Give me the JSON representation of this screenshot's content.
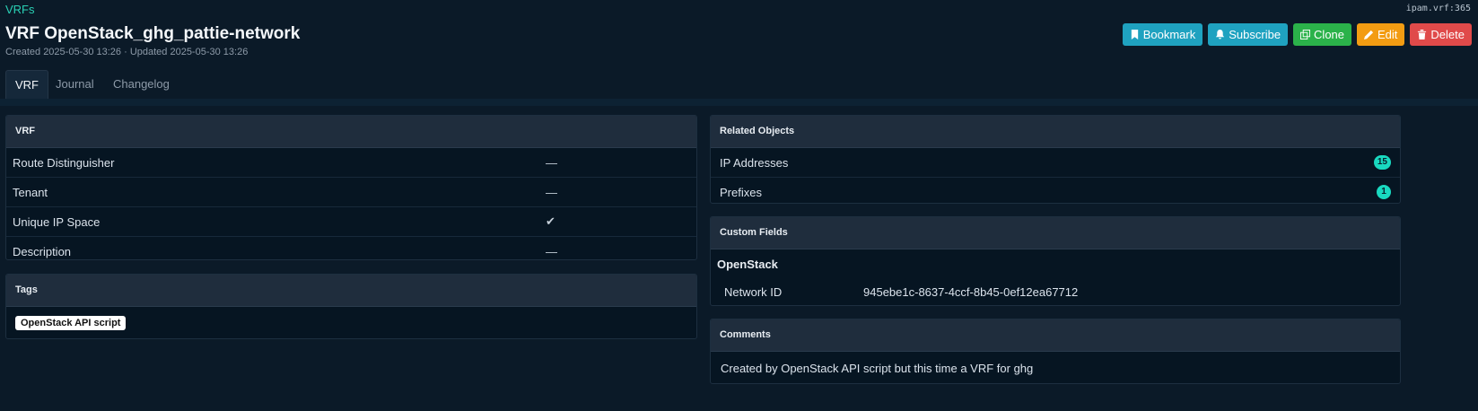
{
  "breadcrumb": {
    "label": "VRFs"
  },
  "object_id": "ipam.vrf:365",
  "page": {
    "title": "VRF OpenStack_ghg_pattie-network",
    "meta": "Created 2025-05-30 13:26 · Updated 2025-05-30 13:26"
  },
  "actions": {
    "bookmark": "Bookmark",
    "subscribe": "Subscribe",
    "clone": "Clone",
    "edit": "Edit",
    "delete": "Delete"
  },
  "tabs": [
    "VRF",
    "Journal",
    "Changelog"
  ],
  "vrf_card": {
    "title": "VRF",
    "rows": [
      {
        "label": "Route Distinguisher",
        "value": "—"
      },
      {
        "label": "Tenant",
        "value": "—"
      },
      {
        "label": "Unique IP Space",
        "value": "✔"
      },
      {
        "label": "Description",
        "value": "—"
      }
    ]
  },
  "tags_card": {
    "title": "Tags",
    "tags": [
      "OpenStack API script"
    ]
  },
  "related_card": {
    "title": "Related Objects",
    "rows": [
      {
        "label": "IP Addresses",
        "count": "15"
      },
      {
        "label": "Prefixes",
        "count": "1"
      }
    ]
  },
  "custom_fields_card": {
    "title": "Custom Fields",
    "group": "OpenStack",
    "field": {
      "label": "Network ID",
      "value": "945ebe1c-8637-4ccf-8b45-0ef12ea67712"
    }
  },
  "comments_card": {
    "title": "Comments",
    "text": "Created by OpenStack API script but this time a VRF for ghg"
  },
  "colors": {
    "background": "#0b1a28",
    "accent": "#2ad1b5",
    "bookmark": "#1fa2c0",
    "clone": "#2bb24a",
    "edit": "#f39c12",
    "delete": "#e04a4a",
    "badge": "#19d9c0",
    "check": "#38b54a"
  }
}
